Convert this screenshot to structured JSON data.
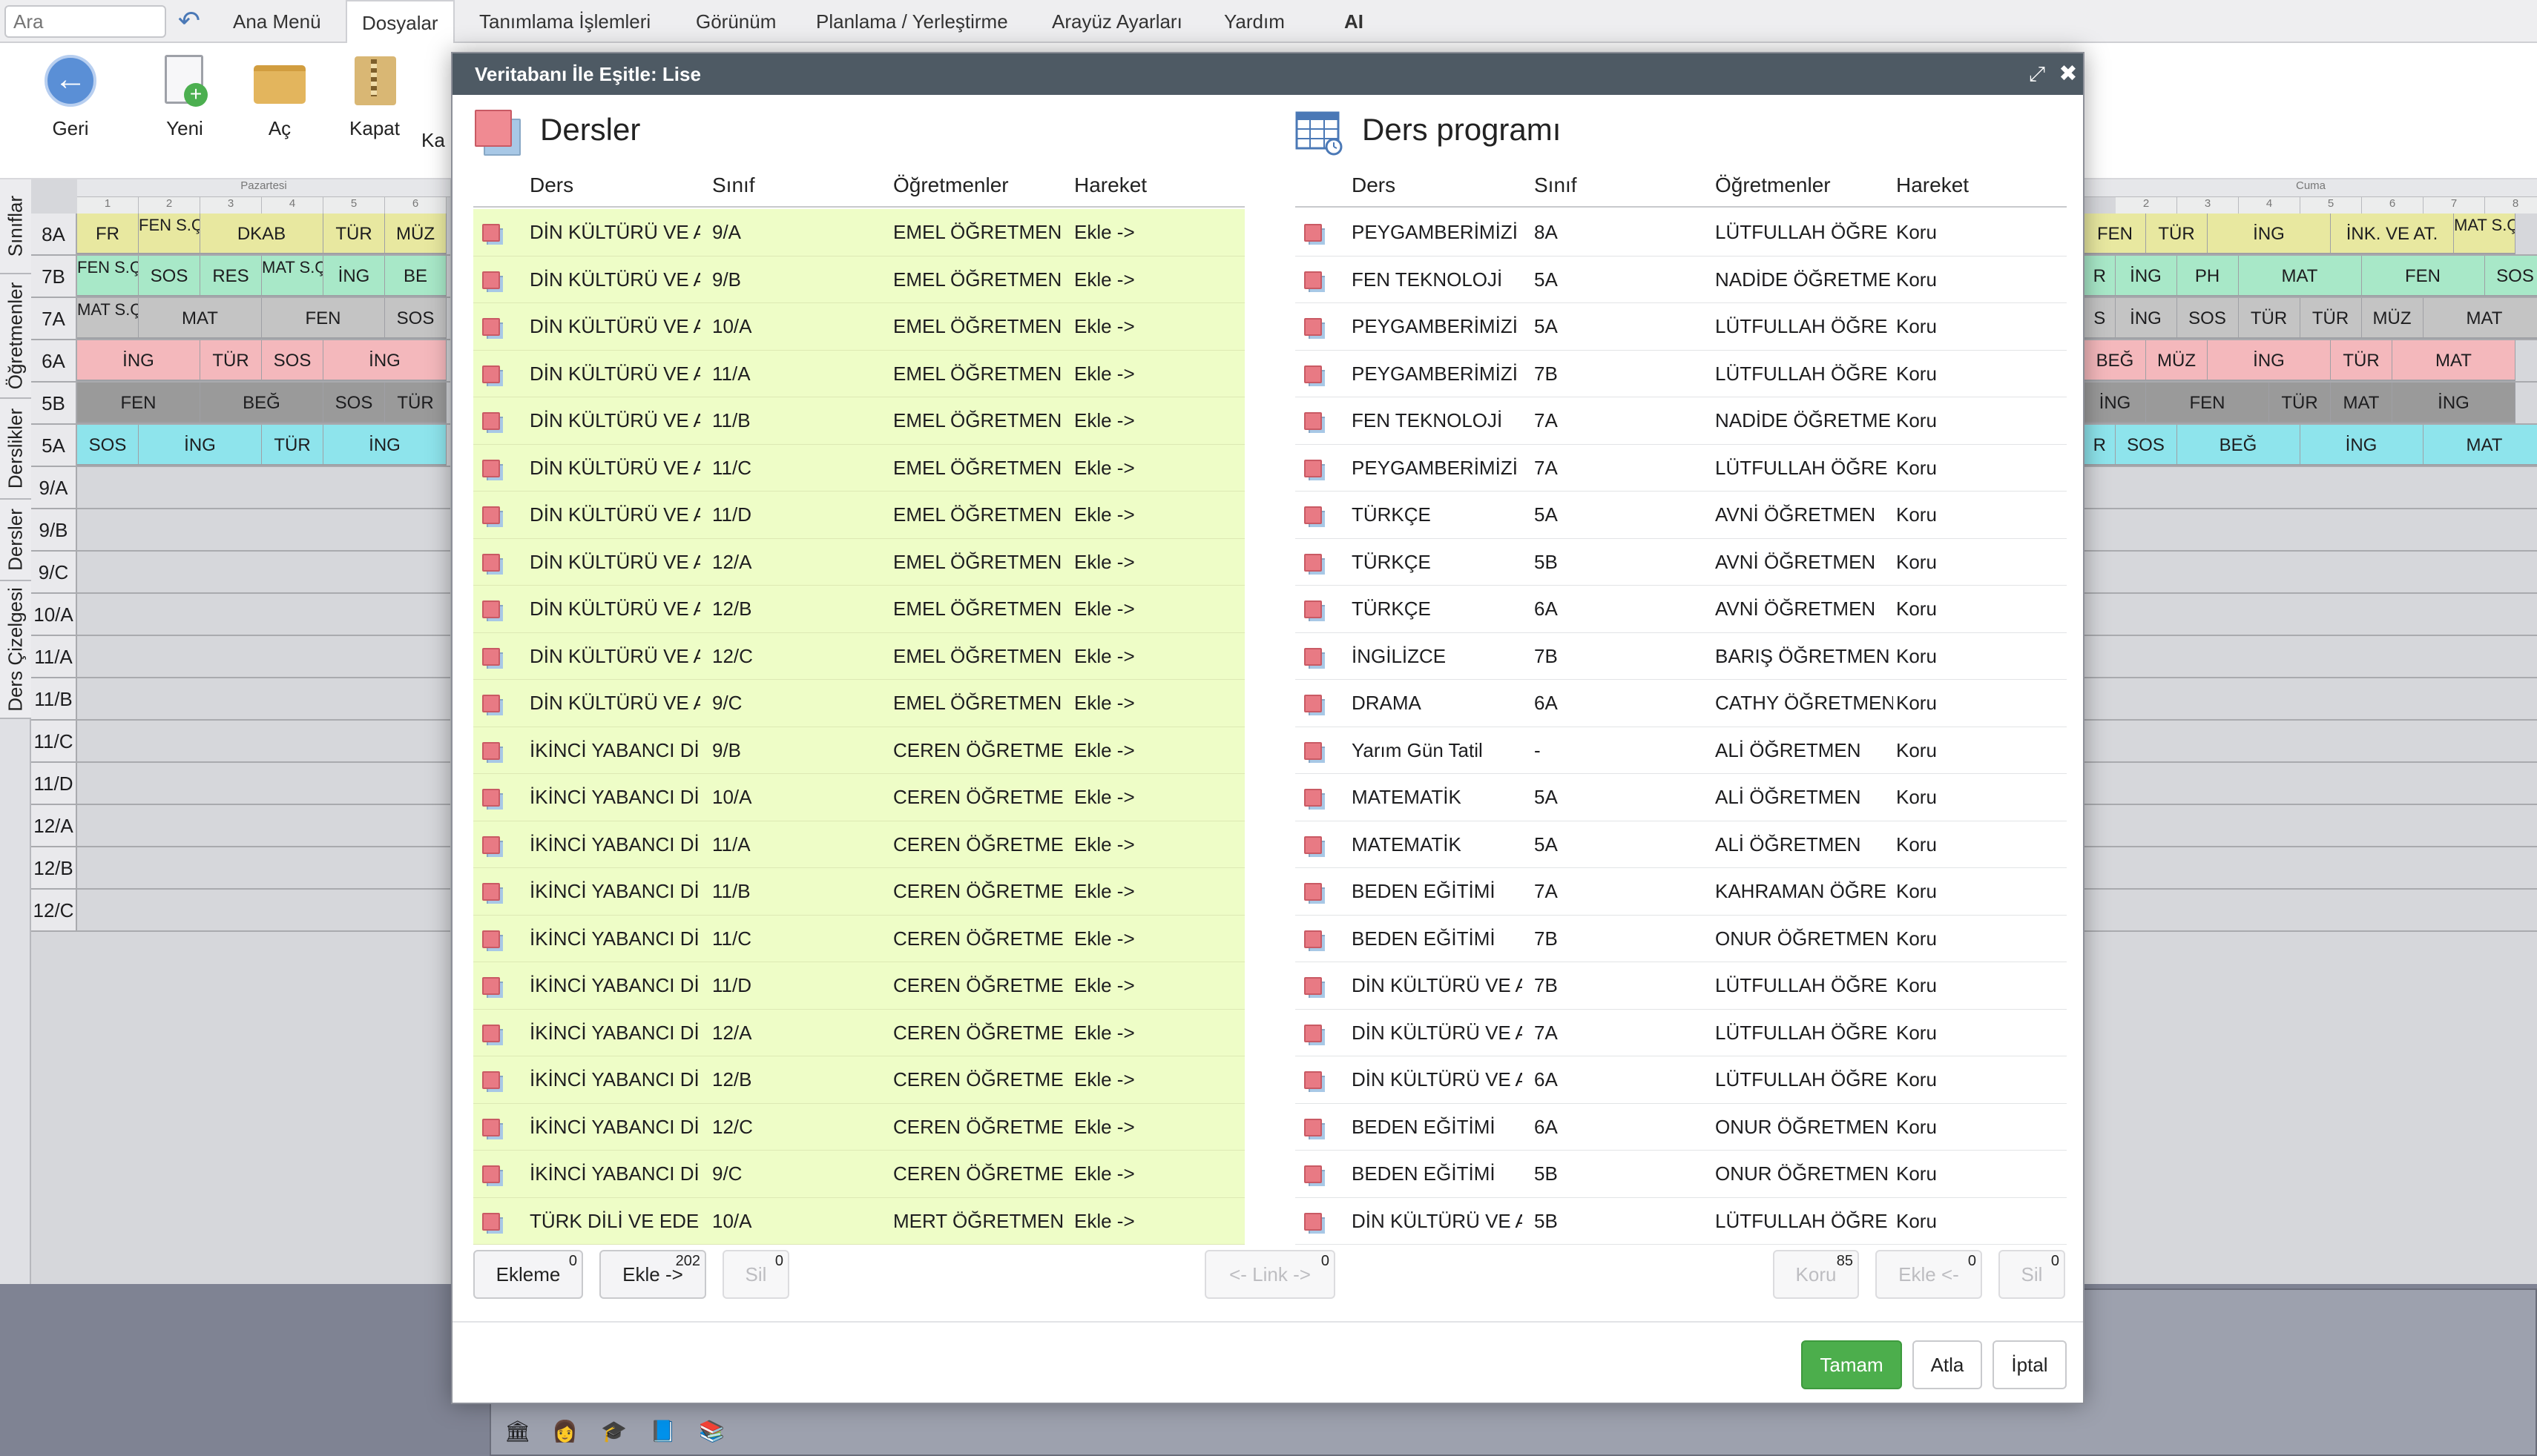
{
  "menubar": {
    "search_placeholder": "Ara",
    "items": [
      "Ana Menü",
      "Dosyalar",
      "Tanımlama İşlemleri",
      "Görünüm",
      "Planlama / Yerleştirme",
      "Arayüz Ayarları",
      "Yardım",
      "AI"
    ],
    "active": "Dosyalar"
  },
  "toolbar": {
    "back": "Geri",
    "new": "Yeni",
    "open": "Aç",
    "close": "Kapat",
    "partial": "Ka"
  },
  "left_tabs": [
    "Sınıflar",
    "Öğretmenler",
    "Derslikler",
    "Dersler",
    "Ders Çizelgesi"
  ],
  "timetable": {
    "day_left": "Pazartesi",
    "day_right": "Cuma",
    "col_numbers_left": [
      "1",
      "2",
      "3",
      "4",
      "5",
      "6"
    ],
    "col_numbers_right": [
      "2",
      "3",
      "4",
      "5",
      "6",
      "7",
      "8"
    ],
    "rows": [
      "8A",
      "7B",
      "7A",
      "6A",
      "5B",
      "5A",
      "9/A",
      "9/B",
      "9/C",
      "10/A",
      "11/A",
      "11/B",
      "11/C",
      "11/D",
      "12/A",
      "12/B",
      "12/C"
    ],
    "left_cells": [
      [
        {
          "t": "FR",
          "c": "#e8e8a0",
          "w": 1
        },
        {
          "t": "FEN S.Ç.",
          "c": "#e8e8a0",
          "w": 1
        },
        {
          "t": "DKAB",
          "c": "#e8e8a0",
          "w": 2
        },
        {
          "t": "TÜR",
          "c": "#e8e8a0",
          "w": 1
        },
        {
          "t": "MÜZ",
          "c": "#e8e8a0",
          "w": 1
        }
      ],
      [
        {
          "t": "FEN S.Ç.",
          "c": "#a8e8c8",
          "w": 1
        },
        {
          "t": "SOS",
          "c": "#a8e8c8",
          "w": 1
        },
        {
          "t": "RES",
          "c": "#a8e8c8",
          "w": 1
        },
        {
          "t": "MAT S.Ç.",
          "c": "#a8e8c8",
          "w": 1
        },
        {
          "t": "İNG",
          "c": "#a8e8c8",
          "w": 1
        },
        {
          "t": "BE",
          "c": "#a8e8c8",
          "w": 1
        }
      ],
      [
        {
          "t": "MAT S.Ç.",
          "c": "#c4c4c4",
          "w": 1
        },
        {
          "t": "MAT",
          "c": "#c4c4c4",
          "w": 2
        },
        {
          "t": "FEN",
          "c": "#c4c4c4",
          "w": 2
        },
        {
          "t": "SOS",
          "c": "#c4c4c4",
          "w": 1
        }
      ],
      [
        {
          "t": "İNG",
          "c": "#f4b8bc",
          "w": 2
        },
        {
          "t": "TÜR",
          "c": "#f4b8bc",
          "w": 1
        },
        {
          "t": "SOS",
          "c": "#f4b8bc",
          "w": 1
        },
        {
          "t": "İNG",
          "c": "#f4b8bc",
          "w": 2
        }
      ],
      [
        {
          "t": "FEN",
          "c": "#9a9a9a",
          "w": 2
        },
        {
          "t": "BEĞ",
          "c": "#9a9a9a",
          "w": 2
        },
        {
          "t": "SOS",
          "c": "#9a9a9a",
          "w": 1
        },
        {
          "t": "TÜR",
          "c": "#9a9a9a",
          "w": 1
        }
      ],
      [
        {
          "t": "SOS",
          "c": "#8ee4ec",
          "w": 1
        },
        {
          "t": "İNG",
          "c": "#8ee4ec",
          "w": 2
        },
        {
          "t": "TÜR",
          "c": "#8ee4ec",
          "w": 1
        },
        {
          "t": "İNG",
          "c": "#8ee4ec",
          "w": 2
        }
      ]
    ],
    "right_cells": [
      [
        {
          "t": "FEN",
          "c": "#e8e8a0",
          "w": 1
        },
        {
          "t": "TÜR",
          "c": "#e8e8a0",
          "w": 1
        },
        {
          "t": "İNG",
          "c": "#e8e8a0",
          "w": 2
        },
        {
          "t": "İNK. VE AT.",
          "c": "#e8e8a0",
          "w": 2
        },
        {
          "t": "MAT S.Ç.",
          "c": "#e8e8a0",
          "w": 1
        }
      ],
      [
        {
          "t": "R",
          "c": "#a8e8c8",
          "w": 0.5
        },
        {
          "t": "İNG",
          "c": "#a8e8c8",
          "w": 1
        },
        {
          "t": "PH",
          "c": "#a8e8c8",
          "w": 1
        },
        {
          "t": "MAT",
          "c": "#a8e8c8",
          "w": 2
        },
        {
          "t": "FEN",
          "c": "#a8e8c8",
          "w": 2
        },
        {
          "t": "SOS",
          "c": "#a8e8c8",
          "w": 1
        }
      ],
      [
        {
          "t": "S",
          "c": "#c4c4c4",
          "w": 0.5
        },
        {
          "t": "İNG",
          "c": "#c4c4c4",
          "w": 1
        },
        {
          "t": "SOS",
          "c": "#c4c4c4",
          "w": 1
        },
        {
          "t": "TÜR",
          "c": "#c4c4c4",
          "w": 1
        },
        {
          "t": "TÜR",
          "c": "#c4c4c4",
          "w": 1
        },
        {
          "t": "MÜZ",
          "c": "#c4c4c4",
          "w": 1
        },
        {
          "t": "MAT",
          "c": "#c4c4c4",
          "w": 2
        }
      ],
      [
        {
          "t": "BEĞ",
          "c": "#f4b8bc",
          "w": 1
        },
        {
          "t": "MÜZ",
          "c": "#f4b8bc",
          "w": 1
        },
        {
          "t": "İNG",
          "c": "#f4b8bc",
          "w": 2
        },
        {
          "t": "TÜR",
          "c": "#f4b8bc",
          "w": 1
        },
        {
          "t": "MAT",
          "c": "#f4b8bc",
          "w": 2
        }
      ],
      [
        {
          "t": "İNG",
          "c": "#9a9a9a",
          "w": 1
        },
        {
          "t": "FEN",
          "c": "#9a9a9a",
          "w": 2
        },
        {
          "t": "TÜR",
          "c": "#9a9a9a",
          "w": 1
        },
        {
          "t": "MAT",
          "c": "#9a9a9a",
          "w": 1
        },
        {
          "t": "İNG",
          "c": "#9a9a9a",
          "w": 2
        }
      ],
      [
        {
          "t": "R",
          "c": "#8ee4ec",
          "w": 0.5
        },
        {
          "t": "SOS",
          "c": "#8ee4ec",
          "w": 1
        },
        {
          "t": "BEĞ",
          "c": "#8ee4ec",
          "w": 2
        },
        {
          "t": "İNG",
          "c": "#8ee4ec",
          "w": 2
        },
        {
          "t": "MAT",
          "c": "#8ee4ec",
          "w": 2
        }
      ]
    ]
  },
  "dialog": {
    "title": "Veritabanı İle Eşitle: Lise",
    "left": {
      "title": "Dersler",
      "headers": [
        "Ders",
        "Sınıf",
        "Öğretmenler",
        "Hareket"
      ],
      "rows": [
        [
          "DİN KÜLTÜRÜ VE A",
          "9/A",
          "EMEL ÖĞRETMEN",
          "Ekle ->"
        ],
        [
          "DİN KÜLTÜRÜ VE A",
          "9/B",
          "EMEL ÖĞRETMEN",
          "Ekle ->"
        ],
        [
          "DİN KÜLTÜRÜ VE A",
          "10/A",
          "EMEL ÖĞRETMEN",
          "Ekle ->"
        ],
        [
          "DİN KÜLTÜRÜ VE A",
          "11/A",
          "EMEL ÖĞRETMEN",
          "Ekle ->"
        ],
        [
          "DİN KÜLTÜRÜ VE A",
          "11/B",
          "EMEL ÖĞRETMEN",
          "Ekle ->"
        ],
        [
          "DİN KÜLTÜRÜ VE A",
          "11/C",
          "EMEL ÖĞRETMEN",
          "Ekle ->"
        ],
        [
          "DİN KÜLTÜRÜ VE A",
          "11/D",
          "EMEL ÖĞRETMEN",
          "Ekle ->"
        ],
        [
          "DİN KÜLTÜRÜ VE A",
          "12/A",
          "EMEL ÖĞRETMEN",
          "Ekle ->"
        ],
        [
          "DİN KÜLTÜRÜ VE A",
          "12/B",
          "EMEL ÖĞRETMEN",
          "Ekle ->"
        ],
        [
          "DİN KÜLTÜRÜ VE A",
          "12/C",
          "EMEL ÖĞRETMEN",
          "Ekle ->"
        ],
        [
          "DİN KÜLTÜRÜ VE A",
          "9/C",
          "EMEL ÖĞRETMEN",
          "Ekle ->"
        ],
        [
          "İKİNCİ YABANCI Dİ",
          "9/B",
          "CEREN ÖĞRETME",
          "Ekle ->"
        ],
        [
          "İKİNCİ YABANCI Dİ",
          "10/A",
          "CEREN ÖĞRETME",
          "Ekle ->"
        ],
        [
          "İKİNCİ YABANCI Dİ",
          "11/A",
          "CEREN ÖĞRETME",
          "Ekle ->"
        ],
        [
          "İKİNCİ YABANCI Dİ",
          "11/B",
          "CEREN ÖĞRETME",
          "Ekle ->"
        ],
        [
          "İKİNCİ YABANCI Dİ",
          "11/C",
          "CEREN ÖĞRETME",
          "Ekle ->"
        ],
        [
          "İKİNCİ YABANCI Dİ",
          "11/D",
          "CEREN ÖĞRETME",
          "Ekle ->"
        ],
        [
          "İKİNCİ YABANCI Dİ",
          "12/A",
          "CEREN ÖĞRETME",
          "Ekle ->"
        ],
        [
          "İKİNCİ YABANCI Dİ",
          "12/B",
          "CEREN ÖĞRETME",
          "Ekle ->"
        ],
        [
          "İKİNCİ YABANCI Dİ",
          "12/C",
          "CEREN ÖĞRETME",
          "Ekle ->"
        ],
        [
          "İKİNCİ YABANCI Dİ",
          "9/C",
          "CEREN ÖĞRETME",
          "Ekle ->"
        ],
        [
          "TÜRK DİLİ VE EDE",
          "10/A",
          "MERT ÖĞRETMEN",
          "Ekle ->"
        ]
      ]
    },
    "right": {
      "title": "Ders programı",
      "headers": [
        "Ders",
        "Sınıf",
        "Öğretmenler",
        "Hareket"
      ],
      "rows": [
        [
          "PEYGAMBERİMİZİ",
          "8A",
          "LÜTFULLAH ÖĞRE",
          "Koru"
        ],
        [
          "FEN TEKNOLOJİ",
          "5A",
          "NADİDE ÖĞRETME",
          "Koru"
        ],
        [
          "PEYGAMBERİMİZİ",
          "5A",
          "LÜTFULLAH ÖĞRE",
          "Koru"
        ],
        [
          "PEYGAMBERİMİZİ",
          "7B",
          "LÜTFULLAH ÖĞRE",
          "Koru"
        ],
        [
          "FEN TEKNOLOJİ",
          "7A",
          "NADİDE ÖĞRETME",
          "Koru"
        ],
        [
          "PEYGAMBERİMİZİ",
          "7A",
          "LÜTFULLAH ÖĞRE",
          "Koru"
        ],
        [
          "TÜRKÇE",
          "5A",
          "AVNİ ÖĞRETMEN",
          "Koru"
        ],
        [
          "TÜRKÇE",
          "5B",
          "AVNİ ÖĞRETMEN",
          "Koru"
        ],
        [
          "TÜRKÇE",
          "6A",
          "AVNİ ÖĞRETMEN",
          "Koru"
        ],
        [
          "İNGİLİZCE",
          "7B",
          "BARIŞ ÖĞRETMEN",
          "Koru"
        ],
        [
          "DRAMA",
          "6A",
          "CATHY ÖĞRETMEN",
          "Koru"
        ],
        [
          "Yarım Gün Tatil",
          "-",
          "ALİ ÖĞRETMEN",
          "Koru"
        ],
        [
          "MATEMATİK",
          "5A",
          "ALİ ÖĞRETMEN",
          "Koru"
        ],
        [
          "MATEMATİK",
          "5A",
          "ALİ ÖĞRETMEN",
          "Koru"
        ],
        [
          "BEDEN EĞİTİMİ",
          "7A",
          "KAHRAMAN ÖĞRE",
          "Koru"
        ],
        [
          "BEDEN EĞİTİMİ",
          "7B",
          "ONUR ÖĞRETMEN",
          "Koru"
        ],
        [
          "DİN KÜLTÜRÜ VE A",
          "7B",
          "LÜTFULLAH ÖĞRE",
          "Koru"
        ],
        [
          "DİN KÜLTÜRÜ VE A",
          "7A",
          "LÜTFULLAH ÖĞRE",
          "Koru"
        ],
        [
          "DİN KÜLTÜRÜ VE A",
          "6A",
          "LÜTFULLAH ÖĞRE",
          "Koru"
        ],
        [
          "BEDEN EĞİTİMİ",
          "6A",
          "ONUR ÖĞRETMEN",
          "Koru"
        ],
        [
          "BEDEN EĞİTİMİ",
          "5B",
          "ONUR ÖĞRETMEN",
          "Koru"
        ],
        [
          "DİN KÜLTÜRÜ VE A",
          "5B",
          "LÜTFULLAH ÖĞRE",
          "Koru"
        ]
      ]
    },
    "buttons": {
      "no_add": {
        "label": "Ekleme",
        "count": "0"
      },
      "add": {
        "label": "Ekle ->",
        "count": "202"
      },
      "delete_left": {
        "label": "Sil",
        "count": "0"
      },
      "link": {
        "label": "<- Link ->",
        "count": "0"
      },
      "keep": {
        "label": "Koru",
        "count": "85"
      },
      "add_back": {
        "label": "Ekle <-",
        "count": "0"
      },
      "delete_right": {
        "label": "Sil",
        "count": "0"
      },
      "ok": "Tamam",
      "skip": "Atla",
      "cancel": "İptal"
    }
  },
  "colors": {
    "ok_green": "#4cae4c",
    "title_bar": "#4e5a64",
    "left_list_bg": "#eefdc7",
    "accent_blue": "#5a8fd6"
  }
}
